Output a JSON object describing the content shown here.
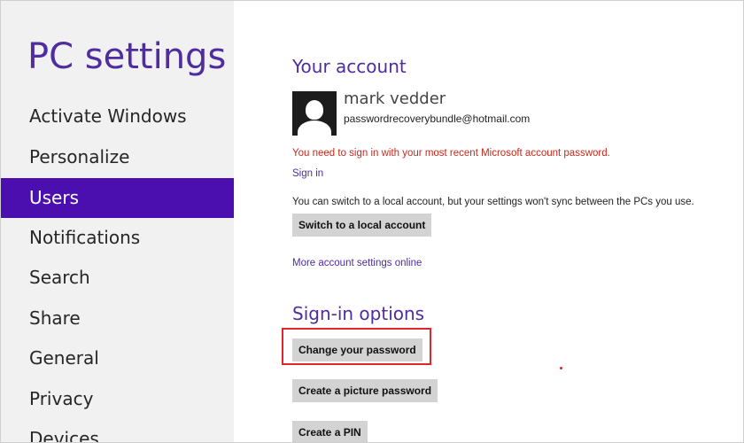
{
  "sidebar": {
    "title": "PC settings",
    "items": [
      {
        "label": "Activate Windows"
      },
      {
        "label": "Personalize"
      },
      {
        "label": "Users",
        "selected": true
      },
      {
        "label": "Notifications"
      },
      {
        "label": "Search"
      },
      {
        "label": "Share"
      },
      {
        "label": "General"
      },
      {
        "label": "Privacy"
      },
      {
        "label": "Devices"
      }
    ]
  },
  "account": {
    "title": "Your account",
    "avatar_icon": "user-silhouette-icon",
    "name": "mark vedder",
    "email": "passwordrecoverybundle@hotmail.com",
    "warning": "You need to sign in with your most recent Microsoft account password.",
    "sign_in_link": "Sign in",
    "local_note": "You can switch to a local account, but your settings won't sync between the PCs you use.",
    "switch_button": "Switch to a local account",
    "more_link": "More account settings online"
  },
  "signin_options": {
    "title": "Sign-in options",
    "change_password_button": "Change your password",
    "picture_password_button": "Create a picture password",
    "pin_button": "Create a PIN"
  },
  "colors": {
    "accent": "#4b0fb0",
    "title": "#4f2c9f",
    "warning": "#c8281a",
    "highlight": "#e0262a"
  }
}
